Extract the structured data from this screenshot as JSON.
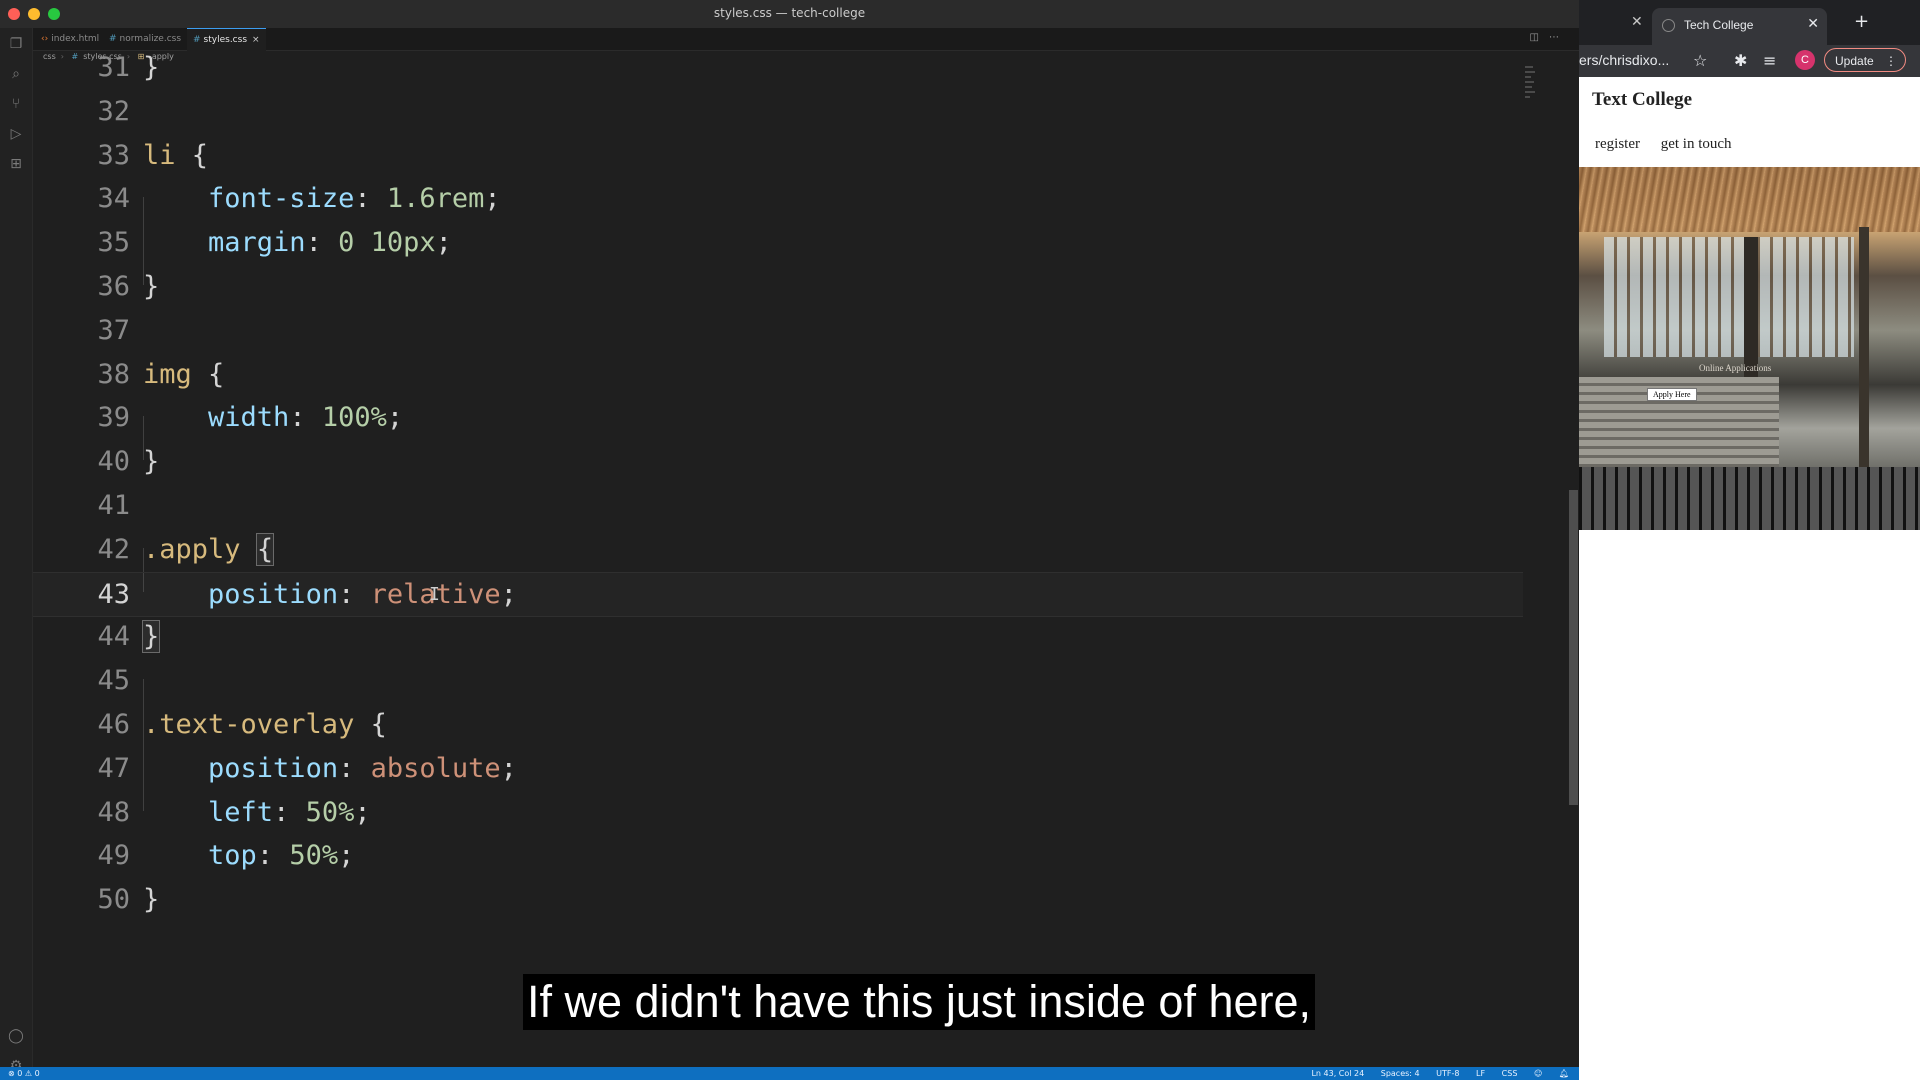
{
  "window": {
    "title": "styles.css — tech-college"
  },
  "tabs": [
    {
      "label": "index.html",
      "icon": "html-file-icon"
    },
    {
      "label": "normalize.css",
      "icon": "css-file-icon"
    },
    {
      "label": "styles.css",
      "icon": "css-file-icon",
      "active": true
    }
  ],
  "breadcrumb": {
    "folder": "css",
    "file": "styles.css",
    "symbol": ".apply"
  },
  "code": {
    "lines": [
      {
        "n": "31",
        "segments": [
          [
            "punc",
            "}"
          ]
        ]
      },
      {
        "n": "32",
        "segments": []
      },
      {
        "n": "33",
        "segments": [
          [
            "sel",
            "li"
          ],
          [
            "punc",
            " {"
          ]
        ]
      },
      {
        "n": "34",
        "segments": [
          [
            "punc",
            "    "
          ],
          [
            "prop",
            "font-size"
          ],
          [
            "punc",
            ": "
          ],
          [
            "num",
            "1.6rem"
          ],
          [
            "punc",
            ";"
          ]
        ]
      },
      {
        "n": "35",
        "segments": [
          [
            "punc",
            "    "
          ],
          [
            "prop",
            "margin"
          ],
          [
            "punc",
            ": "
          ],
          [
            "num",
            "0 10px"
          ],
          [
            "punc",
            ";"
          ]
        ]
      },
      {
        "n": "36",
        "segments": [
          [
            "punc",
            "}"
          ]
        ]
      },
      {
        "n": "37",
        "segments": []
      },
      {
        "n": "38",
        "segments": [
          [
            "sel",
            "img"
          ],
          [
            "punc",
            " {"
          ]
        ]
      },
      {
        "n": "39",
        "segments": [
          [
            "punc",
            "    "
          ],
          [
            "prop",
            "width"
          ],
          [
            "punc",
            ": "
          ],
          [
            "num",
            "100%"
          ],
          [
            "punc",
            ";"
          ]
        ]
      },
      {
        "n": "40",
        "segments": [
          [
            "punc",
            "}"
          ]
        ]
      },
      {
        "n": "41",
        "segments": []
      },
      {
        "n": "42",
        "segments": [
          [
            "sel",
            ".apply"
          ],
          [
            "punc",
            " "
          ],
          [
            "bracket",
            "{"
          ]
        ]
      },
      {
        "n": "43",
        "segments": [
          [
            "punc",
            "    "
          ],
          [
            "prop",
            "position"
          ],
          [
            "punc",
            ": "
          ],
          [
            "kw",
            "relative"
          ],
          [
            "punc",
            ";"
          ]
        ],
        "current": true
      },
      {
        "n": "44",
        "segments": [
          [
            "bracket",
            "}"
          ]
        ]
      },
      {
        "n": "45",
        "segments": []
      },
      {
        "n": "46",
        "segments": [
          [
            "sel",
            ".text-overlay"
          ],
          [
            "punc",
            " {"
          ]
        ]
      },
      {
        "n": "47",
        "segments": [
          [
            "punc",
            "    "
          ],
          [
            "prop",
            "position"
          ],
          [
            "punc",
            ": "
          ],
          [
            "kw",
            "absolute"
          ],
          [
            "punc",
            ";"
          ]
        ]
      },
      {
        "n": "48",
        "segments": [
          [
            "punc",
            "    "
          ],
          [
            "prop",
            "left"
          ],
          [
            "punc",
            ": "
          ],
          [
            "num",
            "50%"
          ],
          [
            "punc",
            ";"
          ]
        ]
      },
      {
        "n": "49",
        "segments": [
          [
            "punc",
            "    "
          ],
          [
            "prop",
            "top"
          ],
          [
            "punc",
            ": "
          ],
          [
            "num",
            "50%"
          ],
          [
            "punc",
            ";"
          ]
        ]
      },
      {
        "n": "50",
        "segments": [
          [
            "punc",
            "}"
          ]
        ]
      }
    ]
  },
  "status": {
    "left": "⊗ 0 ⚠ 0",
    "position": "Ln 43, Col 24",
    "spaces": "Spaces: 4",
    "encoding": "UTF-8",
    "eol": "LF",
    "language": "CSS"
  },
  "caption": "If we didn't have this just inside of here,",
  "browser": {
    "tab_title": "Tech College",
    "url": "ers/chrisdixo...",
    "avatar_letter": "C",
    "update_label": "Update",
    "page": {
      "site_title": "Text College",
      "nav": [
        "register",
        "get in touch"
      ],
      "overlay_text": "Online Applications",
      "apply_button": "Apply Here"
    }
  },
  "colors": {
    "selector": "#d7ba7d",
    "property": "#9cdcfe",
    "number": "#b5cea8",
    "keyword": "#ce9178",
    "statusbar": "#0e6fc0"
  }
}
